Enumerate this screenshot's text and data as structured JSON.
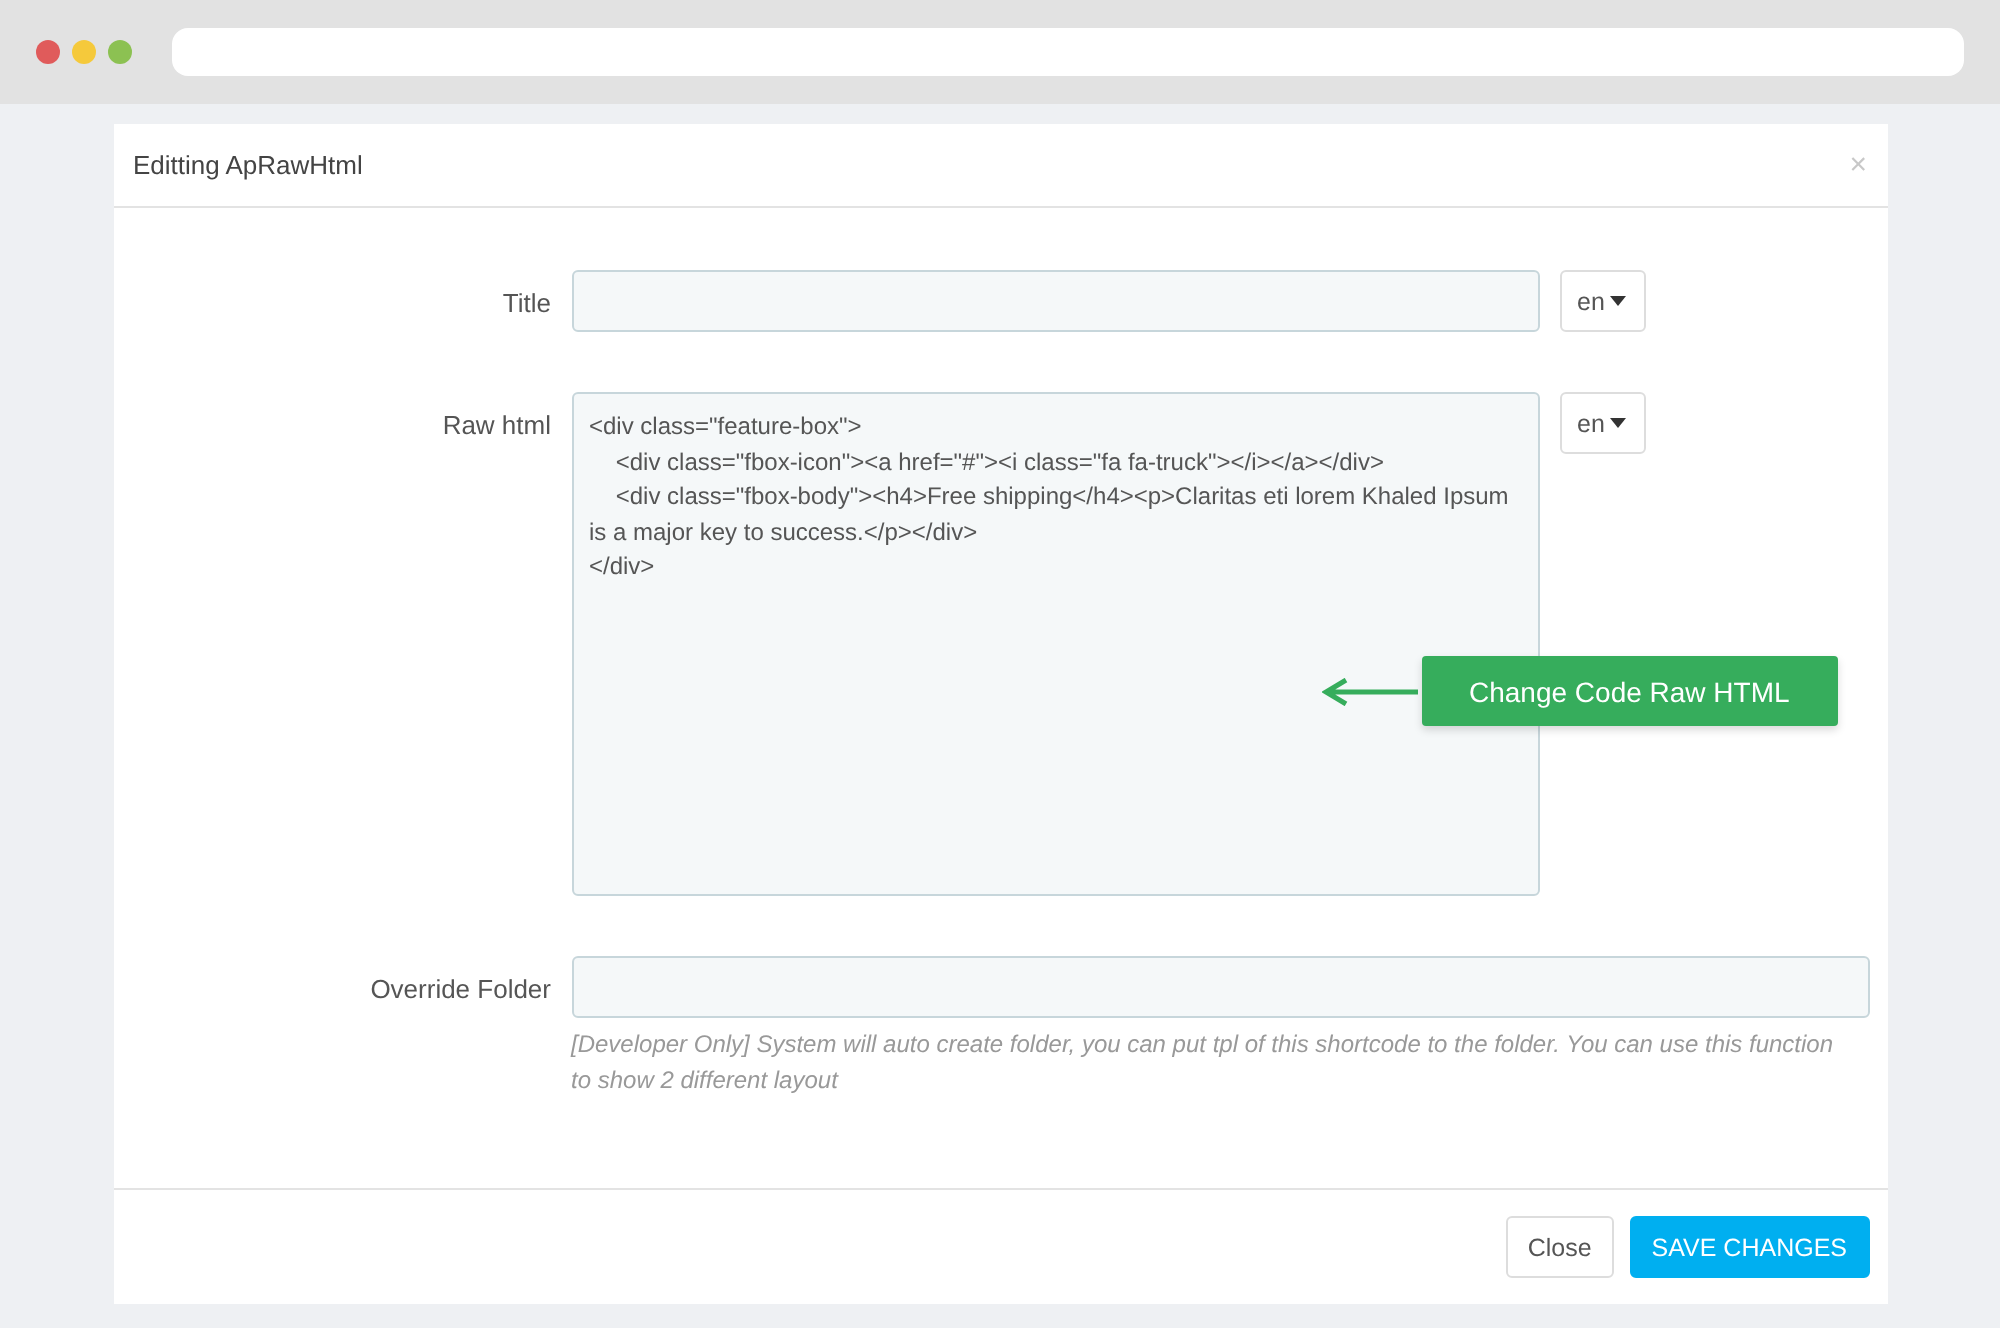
{
  "modal": {
    "title": "Editting ApRawHtml",
    "close": "×"
  },
  "fields": [
    {
      "kind": "input",
      "label": "Title",
      "language": "en"
    },
    {
      "kind": "code",
      "label": "Raw html",
      "language": "en",
      "code": "<div class=\"feature-box\">\n    <div class=\"fbox-icon\"><a href=\"#\"><i class=\"fa fa-truck\"></i></a></div>\n    <div class=\"fbox-body\"><h4>Free shipping</h4><p>Claritas eti lorem Khaled Ipsum is a major key to success.</p></div>\n</div>"
    },
    {
      "kind": "wide",
      "label": "Override Folder",
      "help": "[Developer Only] System will auto create folder, you can put tpl of this shortcode to the folder. You can use this function to show 2 different layout"
    }
  ],
  "callout": "Change Code Raw HTML",
  "buttons": [
    {
      "label": "Close",
      "kind": "default"
    },
    {
      "label": "SAVE CHANGES",
      "kind": "primary"
    }
  ]
}
